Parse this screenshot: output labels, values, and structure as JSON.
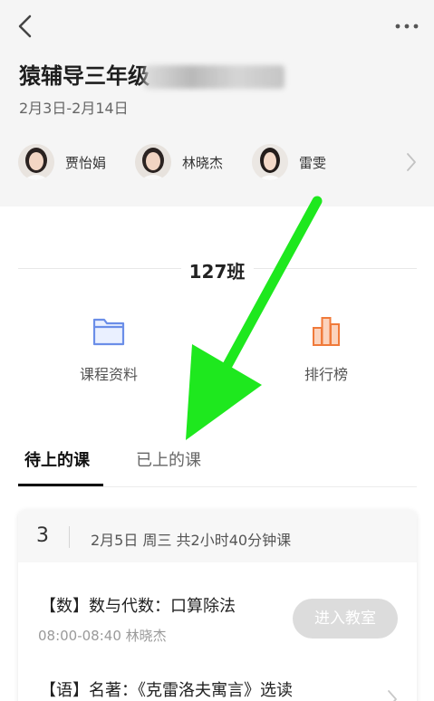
{
  "header": {
    "title": "猿辅导三年级",
    "date_range": "2月3日-2月14日",
    "teachers": [
      {
        "name": "贾怡娟"
      },
      {
        "name": "林晓杰"
      },
      {
        "name": "雷雯"
      }
    ]
  },
  "class_name": "127班",
  "tools": [
    {
      "label": "课程资料",
      "icon": "folder-icon",
      "color": "#6b8ee8"
    },
    {
      "label": "排行榜",
      "icon": "bar-chart-icon",
      "color": "#f07a3a"
    }
  ],
  "tabs": [
    {
      "label": "待上的课",
      "active": true
    },
    {
      "label": "已上的课",
      "active": false
    }
  ],
  "day_card": {
    "number": "3",
    "info": "2月5日 周三 共2小时40分钟课",
    "lessons": [
      {
        "title": "【数】数与代数：口算除法",
        "time_teacher": "08:00-08:40 林晓杰",
        "button": "进入教室"
      },
      {
        "title": "【语】名著：《克雷洛夫寓言》选读"
      }
    ]
  },
  "colors": {
    "annotation_arrow": "#1ee81e",
    "active_tab": "#111111"
  }
}
